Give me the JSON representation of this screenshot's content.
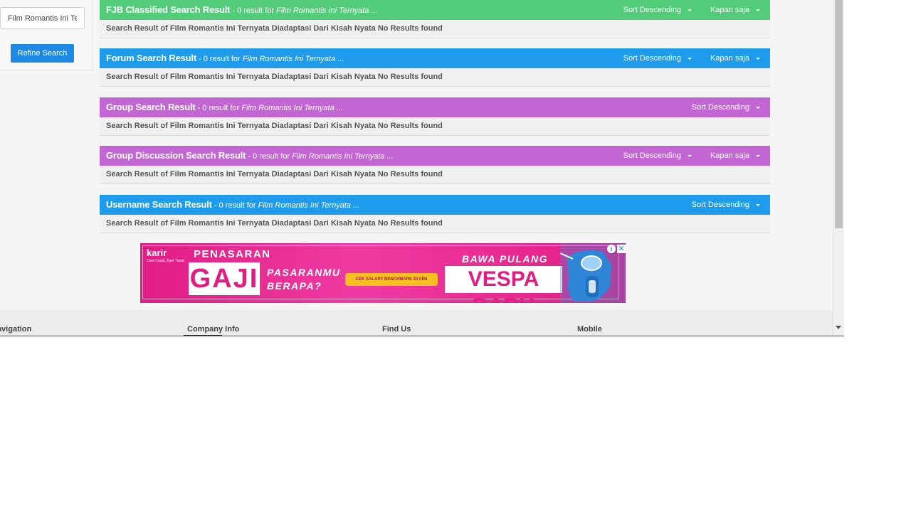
{
  "refine": {
    "input_value": "Film Romantis Ini Ternyata Diadaptasi Dari Kisah Nyata",
    "button_label": "Refine Search"
  },
  "colors": {
    "fjb": "#52cc78",
    "forum": "#1e9bea",
    "group": "#c266d3",
    "group_discussion": "#c266d3",
    "username": "#1e9bea"
  },
  "results": {
    "fjb": {
      "title": "FJB Classified Search Result",
      "count_text": " - 0 result for ",
      "query": "Film Romantis Ini Ternyata ...",
      "sort_label": "Sort Descending",
      "time_label": "Kapan saja",
      "message": "Search Result of Film Romantis Ini Ternyata Diadaptasi Dari Kisah Nyata No Results found"
    },
    "forum": {
      "title": "Forum Search Result",
      "count_text": " - 0 result for ",
      "query": "Film Romantis Ini Ternyata ...",
      "sort_label": "Sort Descending",
      "time_label": "Kapan saja",
      "message": "Search Result of Film Romantis Ini Ternyata Diadaptasi Dari Kisah Nyata No Results found"
    },
    "group": {
      "title": "Group Search Result",
      "count_text": " - 0 result for ",
      "query": "Film Romantis Ini Ternyata ...",
      "sort_label": "Sort Descending",
      "message": "Search Result of Film Romantis Ini Ternyata Diadaptasi Dari Kisah Nyata No Results found"
    },
    "group_discussion": {
      "title": "Group Discussion Search Result",
      "count_text": " - 0 result for ",
      "query": "Film Romantis Ini Ternyata ...",
      "sort_label": "Sort Descending",
      "time_label": "Kapan saja",
      "message": "Search Result of Film Romantis Ini Ternyata Diadaptasi Dari Kisah Nyata No Results found"
    },
    "username": {
      "title": "Username Search Result",
      "count_text": " - 0 result for ",
      "query": "Film Romantis Ini Ternyata ...",
      "sort_label": "Sort Descending",
      "message": "Search Result of Film Romantis Ini Ternyata Diadaptasi Dari Kisah Nyata No Results found"
    }
  },
  "ad": {
    "logo": "karir",
    "logo_tagline": "Cara Cepat, Karir Tepat.",
    "headline": "PENASARAN",
    "gaji": "GAJI",
    "question": "PASARANMU BERAPA?",
    "cta": "CEK SALARY BENCHMARK DI SINI",
    "promo": "BAWA PULANG",
    "vespa": "VESPA BARU",
    "info_icon": "i",
    "close_icon": "✕"
  },
  "footer": {
    "navigation": "Navigation",
    "company_info": "Company Info",
    "find_us": "Find Us",
    "mobile": "Mobile"
  }
}
